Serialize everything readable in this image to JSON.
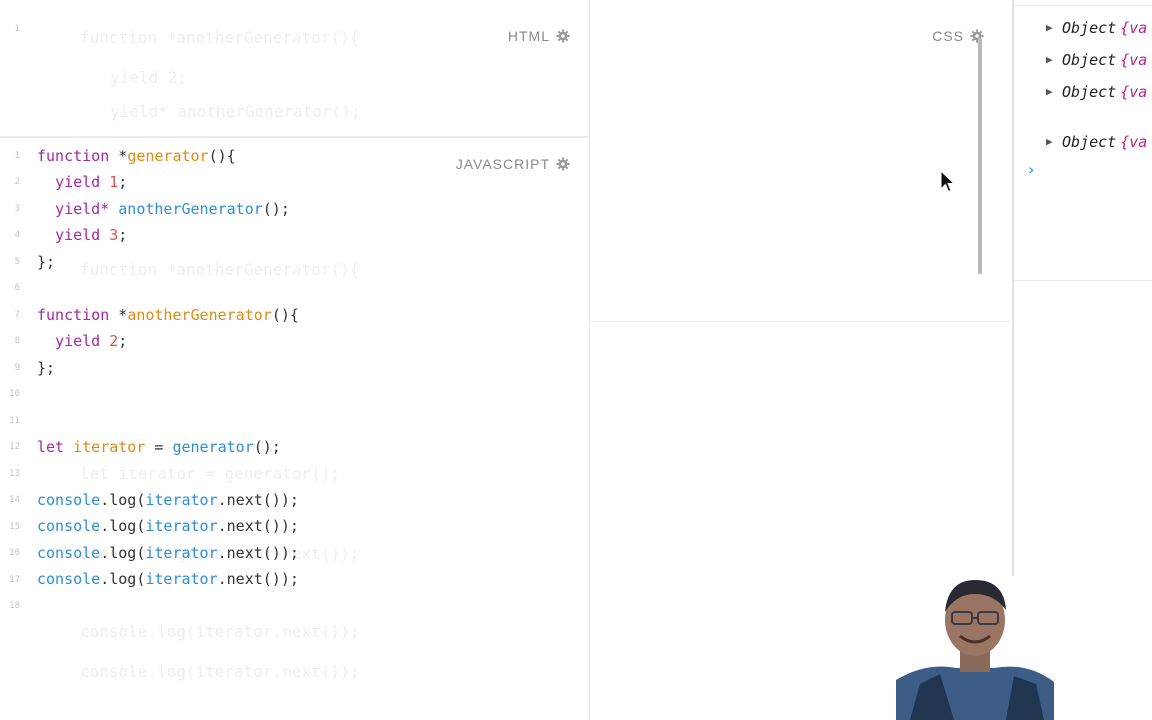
{
  "panes": {
    "html_label": "HTML",
    "javascript_label": "JAVASCRIPT",
    "css_label": "CSS"
  },
  "html_pane": {
    "line_numbers": [
      "1"
    ],
    "ghost_lines": [
      "function *anotherGenerator(){",
      "yield 2;",
      "yield* anotherGenerator();"
    ]
  },
  "javascript_pane": {
    "line_numbers": [
      "1",
      "2",
      "3",
      "4",
      "5",
      "6",
      "7",
      "8",
      "9",
      "10",
      "11",
      "12",
      "13",
      "14",
      "15",
      "16",
      "17",
      "18"
    ],
    "ghost_lines": [
      "function *anotherGenerator(){",
      "let iterator = generator();",
      "console.log(iterator.next());",
      "console.log(iterator.next());",
      "console.log(iterator.next());"
    ],
    "lines": [
      {
        "text": "function *generator(){"
      },
      {
        "text": "  yield 1;"
      },
      {
        "text": "  yield* anotherGenerator();"
      },
      {
        "text": "  yield 3;"
      },
      {
        "text": "};"
      },
      {
        "text": ""
      },
      {
        "text": "function *anotherGenerator(){"
      },
      {
        "text": "  yield 2;"
      },
      {
        "text": "};"
      },
      {
        "text": ""
      },
      {
        "text": ""
      },
      {
        "text": "let iterator = generator();"
      },
      {
        "text": ""
      },
      {
        "text": "console.log(iterator.next());"
      },
      {
        "text": "console.log(iterator.next());"
      },
      {
        "text": "console.log(iterator.next());"
      },
      {
        "text": "console.log(iterator.next());"
      },
      {
        "text": ""
      }
    ],
    "tokens": {
      "l1_kw": "function",
      "l1_star": " *",
      "l1_fn": "generator",
      "l1_rest": "(){",
      "l2_kw": "yield",
      "l2_num": "1",
      "l3_kw": "yield*",
      "l3_call": "anotherGenerator",
      "l3_rest": "();",
      "l4_kw": "yield",
      "l4_num": "3",
      "l5": "};",
      "l7_kw": "function",
      "l7_star": " *",
      "l7_fn": "anotherGenerator",
      "l7_rest": "(){",
      "l8_kw": "yield",
      "l8_num": "2",
      "l9": "};",
      "l12_kw": "let",
      "l12_var": "iterator",
      "l12_eq": " = ",
      "l12_call": "generator",
      "l12_rest": "();",
      "console_kw": "console",
      "log": ".log(",
      "iter": "iterator",
      "next": ".next());"
    }
  },
  "console": {
    "entries": [
      {
        "label": "Object",
        "body": "{va"
      },
      {
        "label": "Object",
        "body": "{va"
      },
      {
        "label": "Object",
        "body": "{va"
      },
      {
        "label": "Object",
        "body": "{va"
      }
    ],
    "prompt_glyph": "›",
    "expand_icon": "triangle-right-icon"
  },
  "colors": {
    "keyword": "#a626a4",
    "function_name": "#e08a12",
    "call": "#2c8fd6",
    "number": "#e05252"
  }
}
